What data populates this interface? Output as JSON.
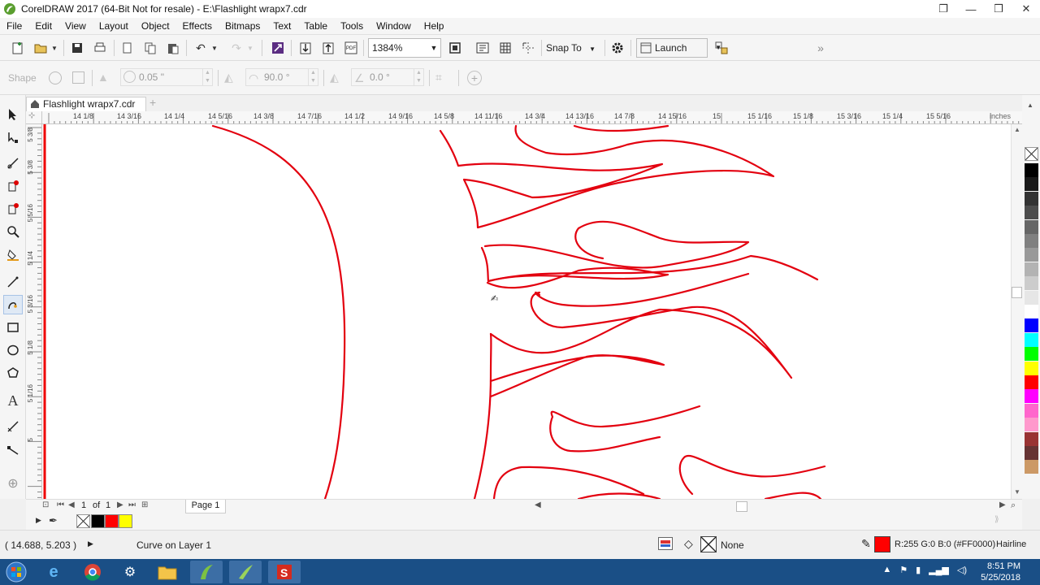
{
  "window": {
    "title": "CorelDRAW 2017 (64-Bit Not for resale) - E:\\Flashlight wrapx7.cdr",
    "controls": [
      "❐",
      "—",
      "❒",
      "✕"
    ]
  },
  "menu": [
    "File",
    "Edit",
    "View",
    "Layout",
    "Object",
    "Effects",
    "Bitmaps",
    "Text",
    "Table",
    "Tools",
    "Window",
    "Help"
  ],
  "toolbar": {
    "zoom_value": "1384%",
    "snap_label": "Snap To",
    "launch_label": "Launch",
    "overflow": "»"
  },
  "propbar": {
    "shape_label": "Shape",
    "outline_width": "0.05 \"",
    "angle": "90.0 °",
    "skew": "0.0 °"
  },
  "document_tab": {
    "name": "Flashlight wrapx7.cdr",
    "add": "+"
  },
  "ruler": {
    "unit": "inches",
    "labels": [
      "14 1/8",
      "14 3/16",
      "14 1/4",
      "14 5/16",
      "14 3/8",
      "14 7/16",
      "14 1/2",
      "14 9/16",
      "14 5/8",
      "14 11/16",
      "14 3/4",
      "14 13/16",
      "14 7/8",
      "14 15/16",
      "15",
      "15 1/16",
      "15 1/8",
      "15 3/16",
      "15 1/4",
      "15 5/16"
    ],
    "vertical_labels": [
      "5 3/8",
      "5 5/16",
      "5 1/4",
      "5 3/16",
      "5 1/8",
      "5 1/16",
      "5"
    ]
  },
  "page_nav": {
    "current": "1",
    "of": "of",
    "total": "1",
    "page_tab": "Page 1"
  },
  "colors": {
    "outline": "#ff0000",
    "palette": [
      "#000000",
      "#1a1a1a",
      "#333333",
      "#4d4d4d",
      "#666666",
      "#808080",
      "#999999",
      "#b3b3b3",
      "#cccccc",
      "#e6e6e6",
      "#ffffff",
      "#0000ff",
      "#00ffff",
      "#00ff00",
      "#ffff00",
      "#ff0000",
      "#ff00ff",
      "#ff66cc",
      "#ff99cc",
      "#993333",
      "#663333",
      "#cc9966"
    ],
    "doc_palette": [
      "#000000",
      "#ff0000",
      "#ffff00"
    ]
  },
  "status": {
    "coords": "( 14.688, 5.203 )",
    "object": "Curve on Layer 1",
    "fill": "None",
    "outline_color": "R:255 G:0 B:0 (#FF0000)",
    "outline_width": "Hairline"
  },
  "taskbar": {
    "time": "8:51 PM",
    "date": "5/25/2018"
  }
}
